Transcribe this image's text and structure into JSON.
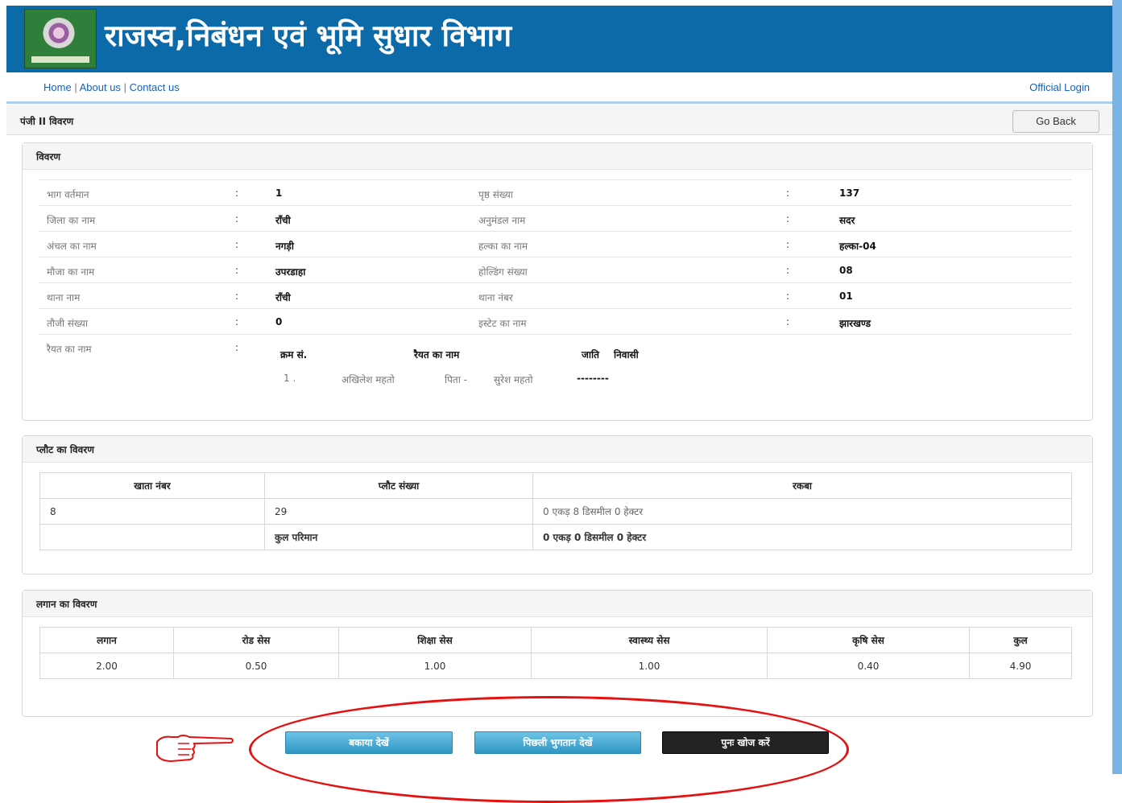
{
  "header": {
    "title": "राजस्व,निबंधन एवं भूमि सुधार विभाग"
  },
  "nav": {
    "home": "Home",
    "about": "About us",
    "contact": "Contact us",
    "sep": "|",
    "official_login": "Official Login"
  },
  "breadcrumb": {
    "text": "पंजी II विवरण",
    "go_back": "Go Back"
  },
  "details": {
    "title": "विवरण",
    "colon": ":",
    "rows": [
      {
        "l1": "भाग वर्तमान",
        "v1": "1",
        "l2": "पृष्ठ संख्या",
        "v2": "137"
      },
      {
        "l1": "जिला का नाम",
        "v1": "राँची",
        "l2": "अनुमंडल नाम",
        "v2": "सदर"
      },
      {
        "l1": "अंचल का नाम",
        "v1": "नगड़ी",
        "l2": "हल्का का नाम",
        "v2": "हल्का-04"
      },
      {
        "l1": "मौजा का नाम",
        "v1": "उपरडाहा",
        "l2": "होल्डिंग संख्या",
        "v2": "08"
      },
      {
        "l1": "थाना नाम",
        "v1": "राँची",
        "l2": "थाना नंबर",
        "v2": "01"
      },
      {
        "l1": "तौजी संख्या",
        "v1": "0",
        "l2": "इस्टेट का नाम",
        "v2": "झारखण्ड"
      }
    ],
    "raiyat_label": "रैयत का नाम",
    "raiyat_headers": {
      "serial": "क्रम सं.",
      "name": "रैयत का नाम",
      "caste": "जाति",
      "resident": "निवासी"
    },
    "raiyat_row": {
      "serial": "1 .",
      "name": "अखिलेश महतो",
      "father_prefix": "पिता -",
      "father": "सुरेश महतो",
      "dash": "--------"
    }
  },
  "plot": {
    "title": "प्लौट का विवरण",
    "headers": [
      "खाता नंबर",
      "प्लौट संख्या",
      "रकबा"
    ],
    "rows": [
      {
        "khata": "8",
        "plot": "29",
        "area": "0 एकड़ 8 डिसमील 0 हेक्टर"
      },
      {
        "khata": "",
        "plot": "कुल परिमान",
        "area": "0 एकड़ 0 डिसमील 0 हेक्टर"
      }
    ]
  },
  "lagan": {
    "title": "लगान का विवरण",
    "headers": [
      "लगान",
      "रोड सेस",
      "शिक्षा सेस",
      "स्वास्थ्य सेस",
      "कृषि सेस",
      "कुल"
    ],
    "values": [
      "2.00",
      "0.50",
      "1.00",
      "1.00",
      "0.40",
      "4.90"
    ]
  },
  "buttons": {
    "view_dues": "बकाया देखें",
    "prev_payment": "पिछली भुगतान देखें",
    "search_again": "पुनः खोज करें"
  },
  "colors": {
    "header_bg": "#0d6aa8",
    "annotation": "#e51010"
  }
}
